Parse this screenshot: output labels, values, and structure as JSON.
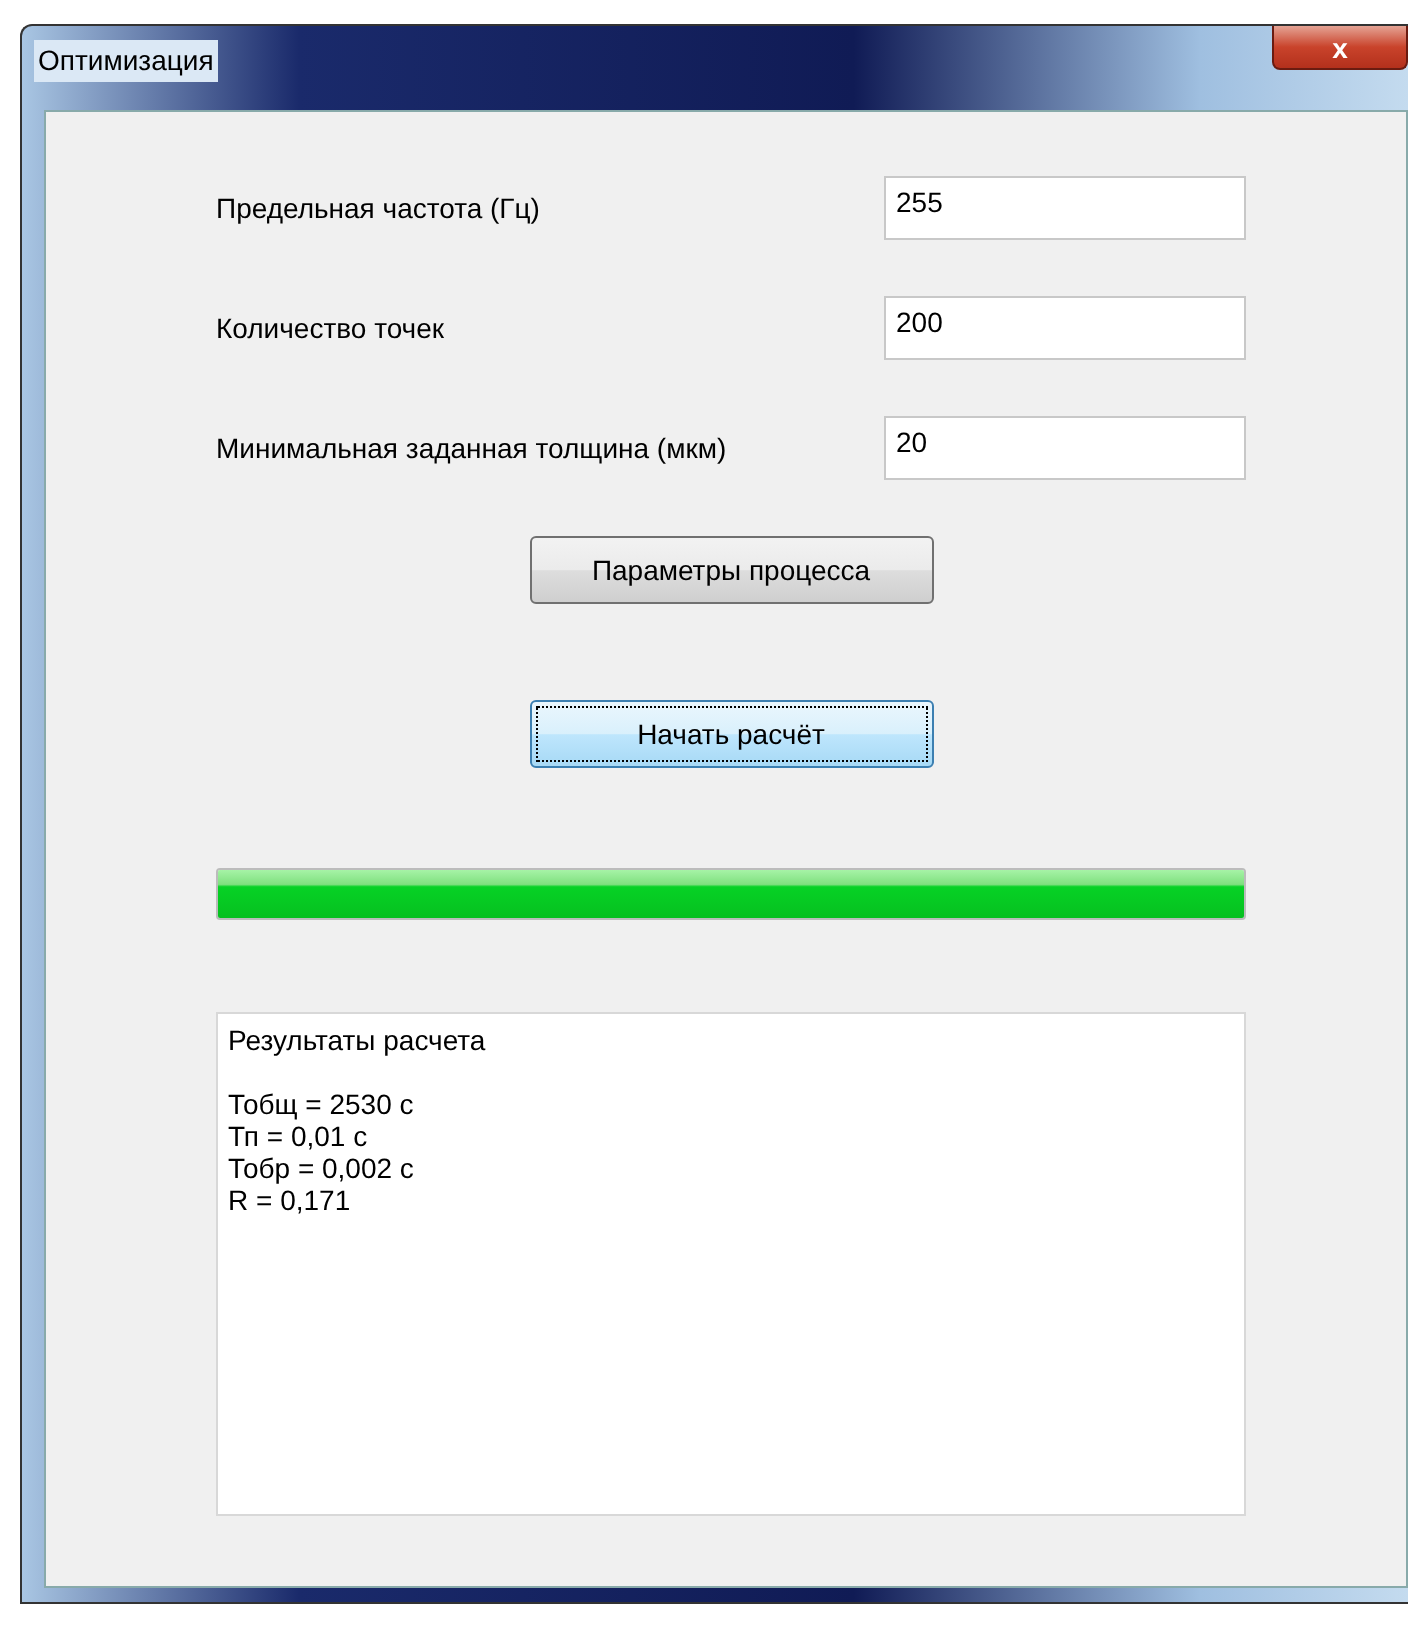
{
  "window": {
    "title": "Оптимизация",
    "close_label": "x"
  },
  "fields": [
    {
      "label": "Предельная частота (Гц)",
      "value": "255"
    },
    {
      "label": "Количество точек",
      "value": "200"
    },
    {
      "label": "Минимальная заданная толщина (мкм)",
      "value": "20"
    }
  ],
  "buttons": [
    {
      "label": "Параметры процесса",
      "focused": false
    },
    {
      "label": "Начать расчёт",
      "focused": true
    }
  ],
  "progress": {
    "level": 1
  },
  "results": {
    "heading": "Результаты расчета",
    "lines": [
      "Тобщ = 2530 с",
      "Тп = 0,01 с",
      "Тобр = 0,002 с",
      "R = 0,171"
    ]
  }
}
